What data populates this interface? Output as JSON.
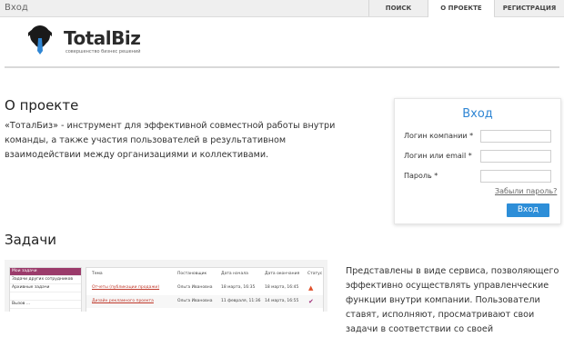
{
  "topbar": {
    "login_link": "Вход",
    "nav": [
      {
        "label": "Поиск"
      },
      {
        "label": "О проекте",
        "active": true
      },
      {
        "label": "Регистрация"
      }
    ]
  },
  "logo": {
    "word": "TotalBiz",
    "tagline": "совершенство бизнес решений",
    "colors": {
      "figure": "#1a1a1a",
      "tie": "#2f86d4"
    }
  },
  "about": {
    "title": "О проекте",
    "text": "«ТоталБиз» - инструмент для эффективной совместной работы внутри команды, а также участия пользователей в результативном взаимодействии между организациями и коллективами."
  },
  "login": {
    "title": "Вход",
    "company_label": "Логин компании *",
    "email_label": "Логин или email *",
    "password_label": "Пароль *",
    "company_value": "",
    "email_value": "",
    "password_value": "",
    "forgot_link": "Забыли пароль?",
    "submit_label": "Вход",
    "accent": "#2d8ed8"
  },
  "tasks": {
    "title": "Задачи",
    "description": "Представлены в виде сервиса, позволяющего эффективно осуществлять управленческие функции внутри компании. Пользователи ставят, исполняют, просматривают свои задачи в соответствии со своей",
    "preview": {
      "side_items": [
        "Мои задачи",
        "Задачи других сотрудников",
        "Архивные задачи",
        "",
        "Вызов ..."
      ],
      "headers": [
        "Тема",
        "Постановщик",
        "Дата начала",
        "Дата окончания",
        "Статус"
      ],
      "rows": [
        [
          "Отчеты (публикации продажи)",
          "Ольга Ивановна",
          "18 марта, 16:35",
          "18 марта, 16:45",
          "flame-icon"
        ],
        [
          "Дизайн рекламного проекта",
          "Ольга Ивановна",
          "11 февраля, 11:36",
          "14 марта, 16:55",
          "check-icon"
        ]
      ]
    }
  }
}
